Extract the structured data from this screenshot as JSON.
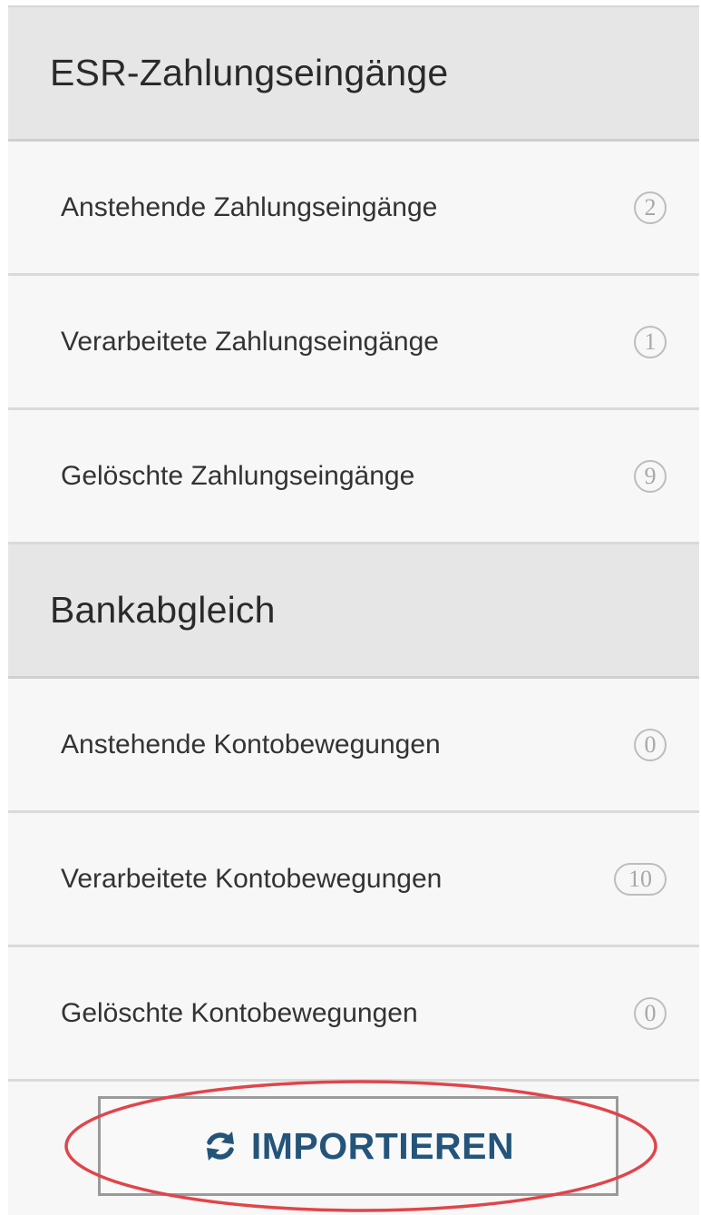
{
  "esr": {
    "title": "ESR-Zahlungseingänge",
    "items": [
      {
        "label": "Anstehende Zahlungseingänge",
        "count": "2"
      },
      {
        "label": "Verarbeitete Zahlungseingänge",
        "count": "1"
      },
      {
        "label": "Gelöschte Zahlungseingänge",
        "count": "9"
      }
    ]
  },
  "bank": {
    "title": "Bankabgleich",
    "items": [
      {
        "label": "Anstehende Kontobewegungen",
        "count": "0"
      },
      {
        "label": "Verarbeitete Kontobewegungen",
        "count": "10"
      },
      {
        "label": "Gelöschte Kontobewegungen",
        "count": "0"
      }
    ]
  },
  "import_button": {
    "label": "IMPORTIEREN",
    "icon": "refresh-icon"
  },
  "colors": {
    "accent_text": "#24547a",
    "highlight": "#e0454a"
  }
}
